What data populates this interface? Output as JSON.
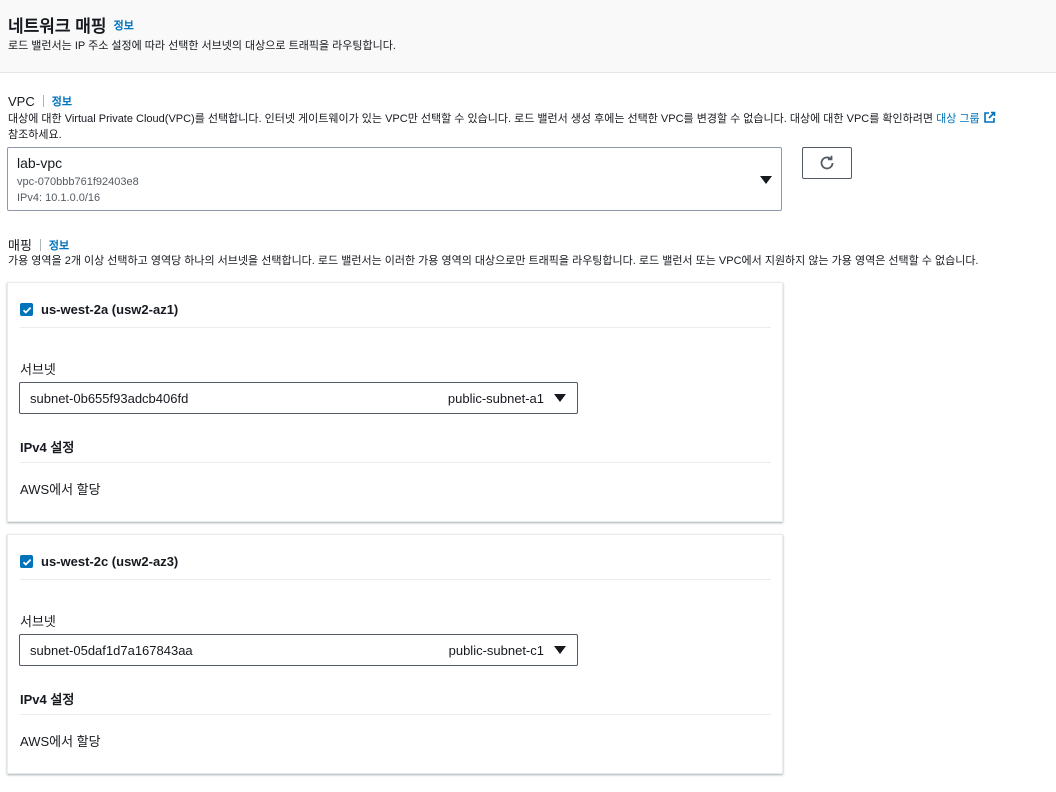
{
  "header": {
    "title": "네트워크 매핑",
    "info": "정보",
    "description": "로드 밸런서는 IP 주소 설정에 따라 선택한 서브넷의 대상으로 트래픽을 라우팅합니다."
  },
  "vpc": {
    "label": "VPC",
    "info": "정보",
    "description_part1": "대상에 대한 Virtual Private Cloud(VPC)를 선택합니다. 인터넷 게이트웨이가 있는 VPC만 선택할 수 있습니다. 로드 밸런서 생성 후에는 선택한 VPC를 변경할 수 없습니다. 대상에 대한 VPC를 확인하려면",
    "description_link": "대상 그룹",
    "description_part2": "참조하세요.",
    "selected_name": "lab-vpc",
    "selected_id": "vpc-070bbb761f92403e8",
    "selected_cidr": "IPv4: 10.1.0.0/16",
    "refresh_icon": "refresh-icon"
  },
  "mapping": {
    "label": "매핑",
    "info": "정보",
    "description": "가용 영역을 2개 이상 선택하고 영역당 하나의 서브넷을 선택합니다. 로드 밸런서는 이러한 가용 영역의 대상으로만 트래픽을 라우팅합니다. 로드 밸런서 또는 VPC에서 지원하지 않는 가용 영역은 선택할 수 없습니다.",
    "zones": [
      {
        "name": "us-west-2a (usw2-az1)",
        "checked": true,
        "subnet_label": "서브넷",
        "subnet_id": "subnet-0b655f93adcb406fd",
        "subnet_name": "public-subnet-a1",
        "ipv4_title": "IPv4 설정",
        "ipv4_value": "AWS에서 할당"
      },
      {
        "name": "us-west-2c (usw2-az3)",
        "checked": true,
        "subnet_label": "서브넷",
        "subnet_id": "subnet-05daf1d7a167843aa",
        "subnet_name": "public-subnet-c1",
        "ipv4_title": "IPv4 설정",
        "ipv4_value": "AWS에서 할당"
      }
    ]
  },
  "colors": {
    "link": "#0073bb",
    "checkbox": "#0073bb",
    "text": "#16191f",
    "header_bg": "#f9f9f9"
  }
}
